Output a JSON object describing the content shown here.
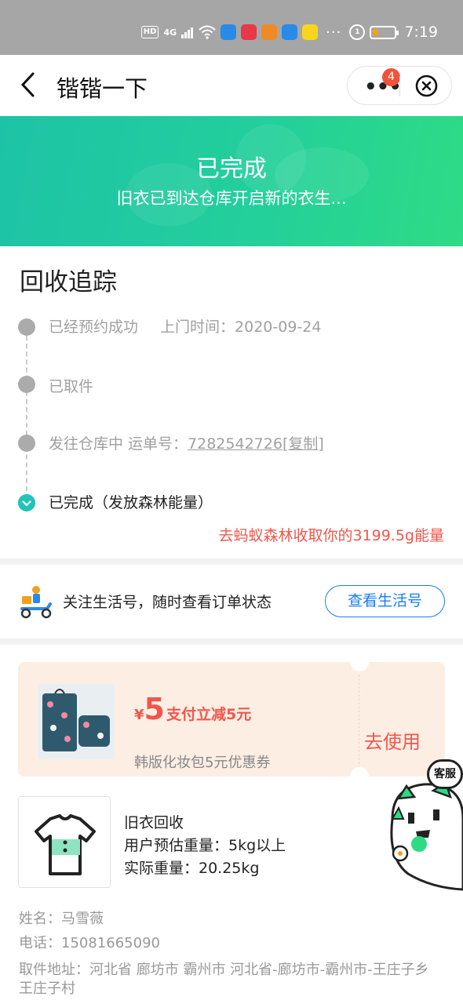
{
  "status_bar": {
    "hd": "HD",
    "network": "4G",
    "time": "7:19",
    "battery_level": 0.25,
    "more": "···"
  },
  "nav": {
    "title": "锴锴一下",
    "badge_count": "4",
    "icons": [
      "back-icon",
      "more-icon",
      "close-icon"
    ]
  },
  "banner": {
    "title": "已完成",
    "subtitle": "旧衣已到达仓库开启新的衣生..."
  },
  "tracking": {
    "title": "回收追踪",
    "steps": [
      {
        "label": "已经预约成功",
        "time": "上门时间：2020-09-24"
      },
      {
        "label": "已取件"
      },
      {
        "label": "发往仓库中 运单号：",
        "waybill": "7282542726",
        "copy": "[复制]"
      },
      {
        "label": "已完成（发放森林能量）"
      }
    ],
    "energy_link": "去蚂蚁森林收取你的3199.5g能量"
  },
  "follow": {
    "text": "关注生活号，随时查看订单状态",
    "button": "查看生活号"
  },
  "coupon": {
    "currency": "¥",
    "amount": "5",
    "desc": "支付立减5元",
    "name": "韩版化妆包5元优惠券",
    "action": "去使用"
  },
  "product": {
    "name": "旧衣回收",
    "estimated": "用户预估重量：5kg以上",
    "actual": "实际重量：20.25kg"
  },
  "contact": {
    "name": "姓名：马雪薇",
    "phone": "电话：15081665090",
    "address_line1": "取件地址：河北省 廊坊市 霸州市 河北省-廊坊市-霸州市-王庄子乡",
    "address_line2": "王庄子村"
  },
  "service": {
    "label": "客服"
  },
  "colors": {
    "banner_start": "#1ec3a7",
    "banner_end": "#2edb85",
    "accent_red": "#f0574c",
    "link_blue": "#1b7cf2",
    "done_teal": "#23c3b9"
  }
}
